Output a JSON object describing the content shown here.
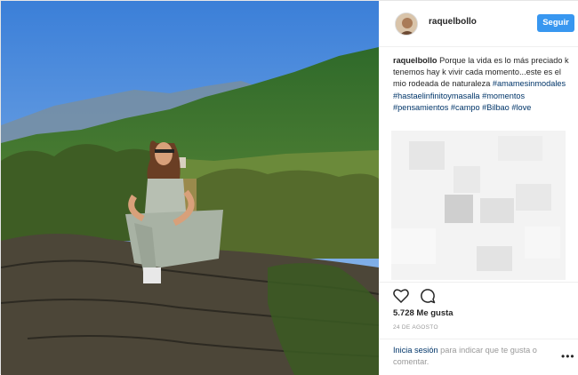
{
  "post": {
    "username": "raquelbollo",
    "follow_label": "Seguir",
    "caption": {
      "user": "raquelbollo",
      "text": "Porque la vida es lo más preciado k tenemos hay k vivir cada momento...este es el mio rodeada de naturaleza",
      "hashtags": [
        "#amamesinmodales",
        "#hastaelinfinitoymasalla",
        "#momentos",
        "#pensamientos",
        "#campo",
        "#Bilbao",
        "#love"
      ]
    },
    "likes": "5.728 Me gusta",
    "date": "24 DE AGOSTO",
    "footer": {
      "login_link": "Inicia sesión",
      "login_text": "para indicar que te gusta o comentar.",
      "more": "•••"
    },
    "icons": {
      "like": "heart-icon",
      "comment": "comment-icon",
      "more": "more-options-icon"
    },
    "colors": {
      "follow_button": "#3897f0",
      "hashtag": "#003569",
      "secondary_text": "#999999"
    }
  }
}
